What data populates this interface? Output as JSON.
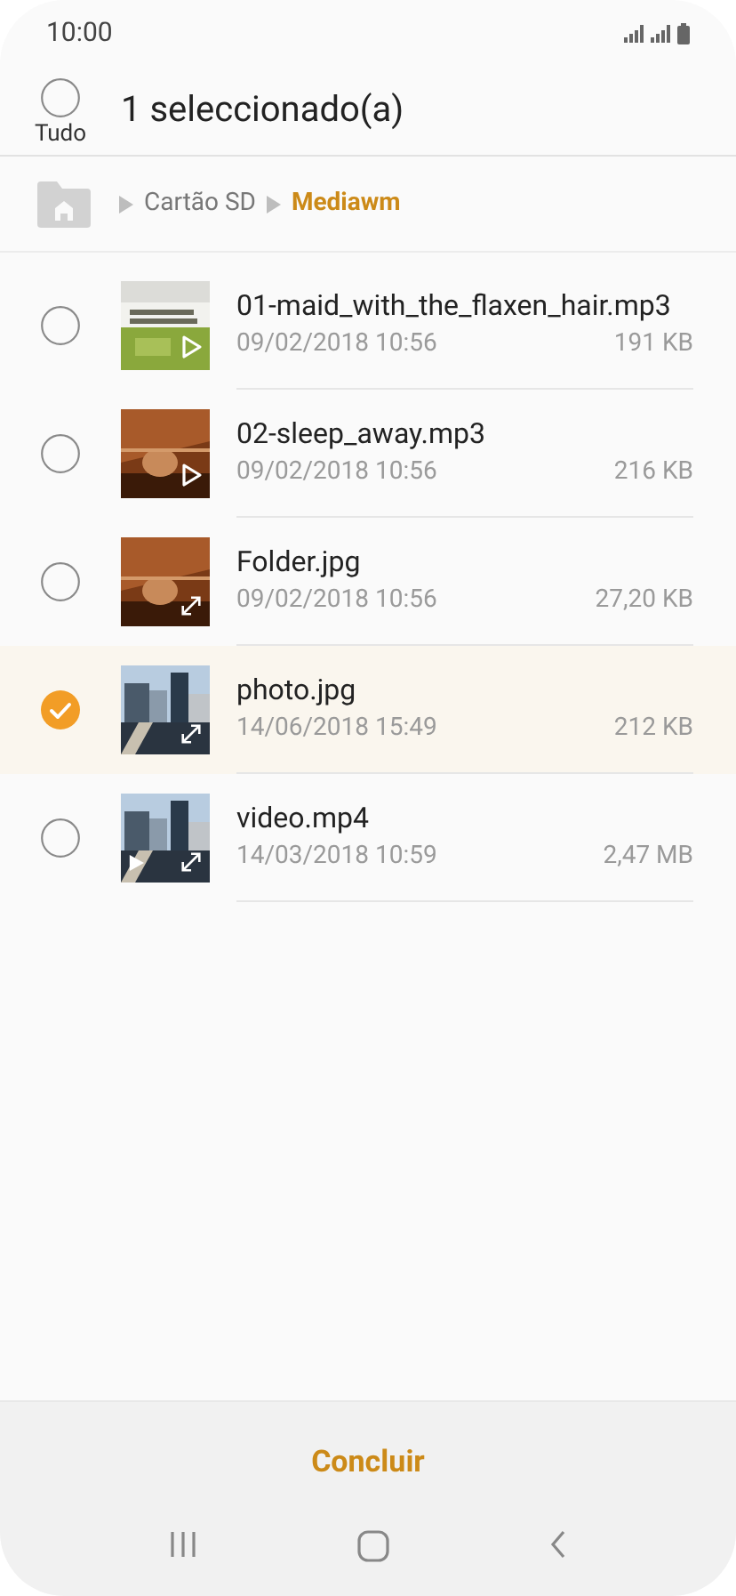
{
  "status_bar": {
    "time": "10:00"
  },
  "header": {
    "select_all": {
      "label": "Tudo",
      "checked": false
    },
    "title": "1 seleccionado(a)"
  },
  "breadcrumb": [
    {
      "label": "Cartão SD",
      "current": false
    },
    {
      "label": "Mediawm",
      "current": true
    }
  ],
  "files": [
    {
      "name": "01-maid_with_the_flaxen_hair.mp3",
      "date": "09/02/2018 10:56",
      "size": "191 KB",
      "kind": "audio",
      "selected": false
    },
    {
      "name": "02-sleep_away.mp3",
      "date": "09/02/2018 10:56",
      "size": "216 KB",
      "kind": "audio",
      "selected": false
    },
    {
      "name": "Folder.jpg",
      "date": "09/02/2018 10:56",
      "size": "27,20 KB",
      "selected": false
    },
    {
      "name": "photo.jpg",
      "date": "14/06/2018 15:49",
      "size": "212 KB",
      "selected": true
    },
    {
      "name": "video.mp4",
      "date": "14/03/2018 10:59",
      "size": "2,47 MB",
      "kind": "video",
      "selected": false
    }
  ],
  "done_button": "Concluir"
}
